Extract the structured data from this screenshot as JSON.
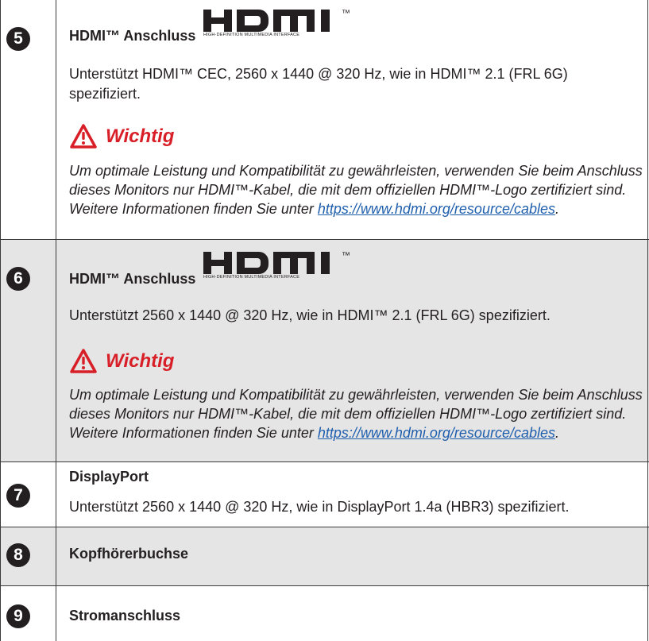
{
  "sections": [
    {
      "number": "5",
      "title": "HDMI™ Anschluss",
      "logo_word": "HDMI",
      "logo_tm": "™",
      "logo_sub": "HIGH-DEFINITION MULTIMEDIA INTERFACE",
      "description": "Unterstützt HDMI™ CEC, 2560 x 1440 @ 320 Hz, wie in HDMI™ 2.1 (FRL 6G) spezifiziert.",
      "important_label": "Wichtig",
      "note_text": "Um optimale Leistung und Kompatibilität zu gewährleisten, verwenden Sie beim Anschluss dieses Monitors nur HDMI™-Kabel, die mit dem offiziellen HDMI™-Logo zertifiziert sind. Weitere Informationen finden Sie unter ",
      "note_link": "https://www.hdmi.org/resource/cables",
      "note_end": "."
    },
    {
      "number": "6",
      "title": "HDMI™ Anschluss",
      "logo_word": "HDMI",
      "logo_tm": "™",
      "logo_sub": "HIGH-DEFINITION MULTIMEDIA INTERFACE",
      "description": "Unterstützt 2560 x 1440 @ 320 Hz, wie in HDMI™ 2.1 (FRL 6G) spezifiziert.",
      "important_label": "Wichtig",
      "note_text": "Um optimale Leistung und Kompatibilität zu gewährleisten, verwenden Sie beim Anschluss dieses Monitors nur HDMI™-Kabel, die mit dem offiziellen HDMI™-Logo zertifiziert sind. Weitere Informationen finden Sie unter ",
      "note_link": "https://www.hdmi.org/resource/cables",
      "note_end": "."
    },
    {
      "number": "7",
      "title": "DisplayPort",
      "description": "Unterstützt 2560 x 1440 @ 320 Hz, wie in DisplayPort 1.4a (HBR3) spezifiziert."
    },
    {
      "number": "8",
      "title": "Kopfhörerbuchse"
    },
    {
      "number": "9",
      "title": "Stromanschluss"
    }
  ],
  "colors": {
    "warning": "#d81e27",
    "link": "#1f5fae",
    "row_gray": "#e5e5e5",
    "text": "#231f20"
  },
  "icons": {
    "warning": "warning-triangle-icon"
  }
}
